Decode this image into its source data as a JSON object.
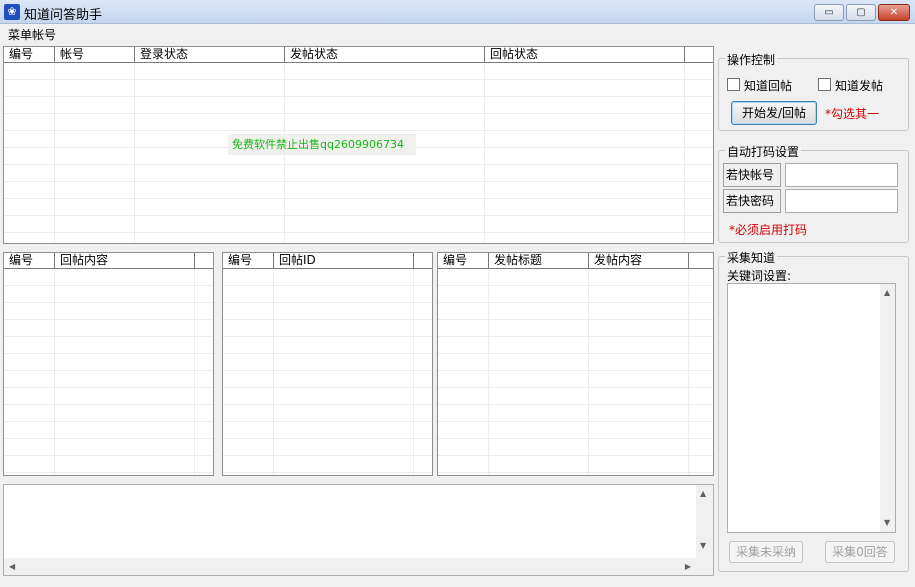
{
  "window": {
    "title": "知道问答助手",
    "controls": {
      "minimize": "▭",
      "maximize": "▢",
      "close": "✕"
    }
  },
  "menu": {
    "items": [
      {
        "label": "菜单帐号"
      }
    ]
  },
  "account_table": {
    "columns": [
      "编号",
      "帐号",
      "登录状态",
      "发帖状态",
      "回帖状态"
    ],
    "watermark": "免费软件禁止出售qq2609906734"
  },
  "reply_content_table": {
    "columns": [
      "编号",
      "回帖内容"
    ]
  },
  "reply_id_table": {
    "columns": [
      "编号",
      "回帖ID"
    ]
  },
  "post_table": {
    "columns": [
      "编号",
      "发帖标题",
      "发帖内容"
    ]
  },
  "operation": {
    "title": "操作控制",
    "reply_checkbox_label": "知道回帖",
    "post_checkbox_label": "知道发帖",
    "start_button": "开始发/回帖",
    "hint": "*勾选其一"
  },
  "captcha": {
    "title": "自动打码设置",
    "account_label": "若快帐号",
    "password_label": "若快密码",
    "account_value": "",
    "password_value": "",
    "hint": "*必须启用打码"
  },
  "collect": {
    "title": "采集知道",
    "keyword_label": "关键词设置:",
    "unaccepted_button": "采集未采纳",
    "zero_answer_button": "采集0回答"
  },
  "colors": {
    "accent_red": "#d40000",
    "watermark_green": "#19b619",
    "title_bar": "#c5d7ee"
  }
}
